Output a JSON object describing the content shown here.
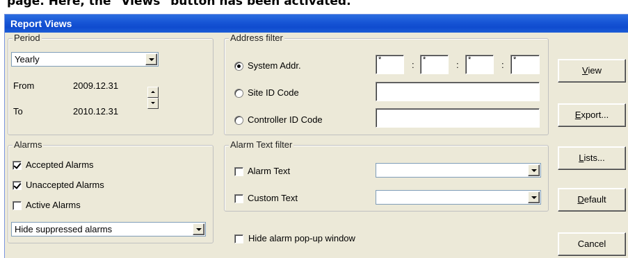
{
  "caption": "page. Here, the \"Views\" button has been activated.",
  "window": {
    "title": "Report Views"
  },
  "period": {
    "legend": "Period",
    "select_value": "Yearly",
    "from_label": "From",
    "from_value": "2009.12.31",
    "to_label": "To",
    "to_value": "2010.12.31"
  },
  "alarms": {
    "legend": "Alarms",
    "accepted": {
      "label": "Accepted Alarms",
      "checked": true
    },
    "unaccepted": {
      "label": "Unaccepted Alarms",
      "checked": true
    },
    "active": {
      "label": "Active Alarms",
      "checked": false
    },
    "select_value": "Hide suppressed alarms"
  },
  "address_filter": {
    "legend": "Address filter",
    "system_addr": {
      "label": "System Addr.",
      "selected": true
    },
    "addr_fields": [
      "*",
      "*",
      "*",
      "*"
    ],
    "site_id": {
      "label": "Site ID Code",
      "selected": false
    },
    "controller_id": {
      "label": "Controller ID Code",
      "selected": false
    }
  },
  "alarm_text_filter": {
    "legend": "Alarm Text filter",
    "alarm_text": {
      "label": "Alarm Text",
      "checked": false
    },
    "custom_text": {
      "label": "Custom Text",
      "checked": false
    }
  },
  "hide_popup": {
    "label": "Hide alarm pop-up window",
    "checked": false
  },
  "buttons": {
    "view": {
      "accel": "V",
      "rest": "iew"
    },
    "export": {
      "accel": "E",
      "rest": "xport..."
    },
    "lists": {
      "accel": "L",
      "rest": "ists..."
    },
    "default": {
      "accel": "D",
      "rest": "efault"
    },
    "cancel": {
      "label": "Cancel"
    }
  }
}
